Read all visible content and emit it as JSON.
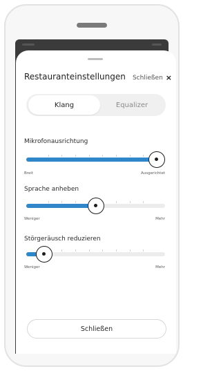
{
  "sheet": {
    "title": "Restauranteinstellungen",
    "close_label": "Schließen",
    "close_icon": "×"
  },
  "tabs": [
    {
      "label": "Klang",
      "active": true
    },
    {
      "label": "Equalizer",
      "active": false
    }
  ],
  "sliders": [
    {
      "label": "Mikrofonausrichtung",
      "min_label": "Breit",
      "max_label": "Ausgerichtet",
      "value_percent": 100
    },
    {
      "label": "Sprache anheben",
      "min_label": "Weniger",
      "max_label": "Mehr",
      "value_percent": 50
    },
    {
      "label": "Störgeräusch reduzieren",
      "min_label": "Weniger",
      "max_label": "Mehr",
      "value_percent": 8
    }
  ],
  "footer": {
    "close_button_label": "Schließen"
  },
  "colors": {
    "accent": "#2f86c9",
    "thumb_border": "#1c1c1c"
  }
}
